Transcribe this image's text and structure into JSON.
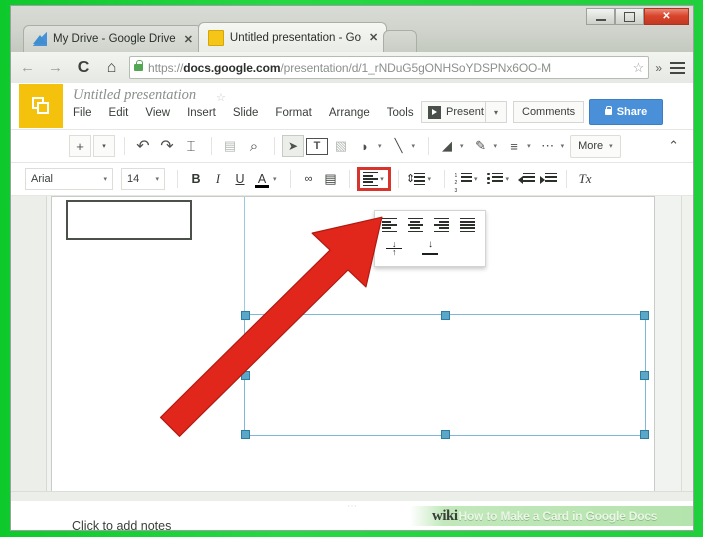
{
  "window": {
    "controls": {
      "minimize": "–",
      "maximize": "□",
      "close": "✕"
    }
  },
  "browser": {
    "tabs": [
      {
        "title": "My Drive - Google Drive",
        "favicon": "drive-icon",
        "close": "✕",
        "active": false
      },
      {
        "title": "Untitled presentation - Go",
        "favicon": "slides-icon",
        "close": "✕",
        "active": true
      }
    ],
    "new_tab_label": "",
    "nav": {
      "back": "←",
      "forward": "→",
      "reload": "C",
      "home": "⌂"
    },
    "omnibox": {
      "scheme": "https://",
      "domain": "docs.google.com",
      "path": "/presentation/d/1_rNDuG5gONHSoYDSPNx6OO-M",
      "full_url": "https://docs.google.com/presentation/d/1_rNDuG5gONHSoYDSPNx6OO-M",
      "lock": "lock-icon",
      "star": "☆"
    },
    "overflow": "»",
    "menu": "hamburger-icon"
  },
  "slides": {
    "doc_title": "Untitled presentation",
    "title_star": "☆",
    "menus": [
      "File",
      "Edit",
      "View",
      "Insert",
      "Slide",
      "Format",
      "Arrange",
      "Tools"
    ],
    "present_label": "Present",
    "present_caret": "▾",
    "comments_label": "Comments",
    "share_label": "Share",
    "toolbar1": [
      {
        "name": "new-slide-button",
        "glyph": "+"
      },
      {
        "name": "new-slide-caret",
        "glyph": "▾"
      },
      {
        "name": "undo-button",
        "glyph": "↶"
      },
      {
        "name": "redo-button",
        "glyph": "↷"
      },
      {
        "name": "paint-format-button",
        "glyph": "⌶"
      },
      {
        "name": "layout-button",
        "glyph": "▤"
      },
      {
        "name": "zoom-button",
        "glyph": "⌕"
      },
      {
        "name": "select-tool-button",
        "glyph": "➤"
      },
      {
        "name": "text-box-button",
        "glyph": "T"
      },
      {
        "name": "insert-image-button",
        "glyph": "▧"
      },
      {
        "name": "shape-button",
        "glyph": "◗"
      },
      {
        "name": "shape-caret",
        "glyph": "▾"
      },
      {
        "name": "line-button",
        "glyph": "╲"
      },
      {
        "name": "line-caret",
        "glyph": "▾"
      },
      {
        "name": "fill-color-button",
        "glyph": "◢"
      },
      {
        "name": "fill-caret",
        "glyph": "▾"
      },
      {
        "name": "line-color-button",
        "glyph": "✎"
      },
      {
        "name": "line-color-caret",
        "glyph": "▾"
      },
      {
        "name": "line-weight-button",
        "glyph": "≡"
      },
      {
        "name": "line-weight-caret",
        "glyph": "▾"
      },
      {
        "name": "line-dash-button",
        "glyph": "⋯"
      },
      {
        "name": "line-dash-caret",
        "glyph": "▾"
      }
    ],
    "more_label": "More",
    "more_caret": "▾",
    "collapse_glyph": "⌃",
    "format_bar": {
      "font_name": "Arial",
      "font_name_caret": "▾",
      "font_size": "14",
      "font_size_caret": "▾",
      "bold": "B",
      "italic": "I",
      "underline": "U",
      "text_color": "A",
      "text_color_caret": "▾",
      "link": "🔗",
      "comment": "▤",
      "align_caret": "▾",
      "line_spacing_caret": "▾",
      "numbered_list_caret": "▾",
      "bulleted_list_caret": "▾",
      "clear_formatting": "Tx"
    },
    "align_dropdown": {
      "open": true,
      "options": [
        "align-left",
        "align-center",
        "align-right",
        "align-justify",
        "align-middle-vertical",
        "align-bottom-vertical"
      ]
    },
    "canvas": {
      "notes_placeholder": "Click to add notes",
      "notes_handle": "⋯"
    }
  },
  "annotation": {
    "arrow_color": "#e1261c",
    "highlight_color": "#d9342b"
  },
  "watermark": {
    "brand": "wiki",
    "text": "How to Make a Card in Google Docs"
  }
}
